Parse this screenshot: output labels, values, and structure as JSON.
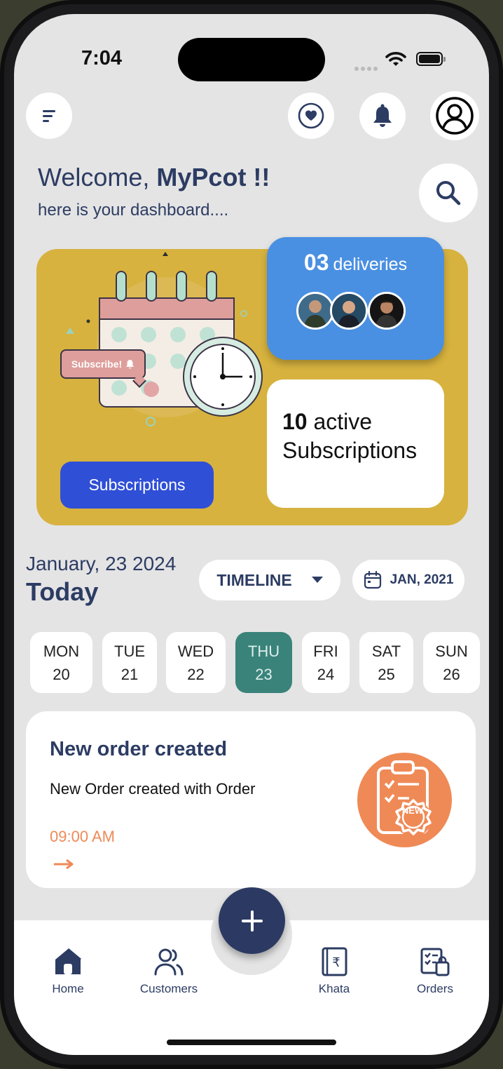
{
  "status_bar": {
    "time": "7:04"
  },
  "header": {
    "welcome_prefix": "Welcome,",
    "user_name": "MyPcot !!",
    "subtitle": "here is your dashboard...."
  },
  "hero": {
    "deliveries_count": "03",
    "deliveries_label": "deliveries",
    "subscribe_tag": "Subscribe!",
    "active_count": "10",
    "active_label": "active",
    "subscriptions_word": "Subscriptions",
    "subscriptions_button": "Subscriptions"
  },
  "dates": {
    "current_date": "January, 23 2024",
    "today_label": "Today",
    "timeline_label": "TIMELINE",
    "month_label": "JAN, 2021",
    "days": [
      {
        "name": "MON",
        "num": "20"
      },
      {
        "name": "TUE",
        "num": "21"
      },
      {
        "name": "WED",
        "num": "22"
      },
      {
        "name": "THU",
        "num": "23"
      },
      {
        "name": "FRI",
        "num": "24"
      },
      {
        "name": "SAT",
        "num": "25"
      },
      {
        "name": "SUN",
        "num": "26"
      }
    ],
    "selected_day": "THU"
  },
  "order_card": {
    "title": "New order created",
    "description": "New Order created with Order",
    "time": "09:00 AM",
    "badge": "NEW"
  },
  "bottom_nav": {
    "items": [
      {
        "label": "Home",
        "icon": "home-icon"
      },
      {
        "label": "Customers",
        "icon": "customers-icon"
      },
      {
        "label": "Khata",
        "icon": "khata-book-icon"
      },
      {
        "label": "Orders",
        "icon": "orders-icon"
      }
    ],
    "fab_icon": "plus-icon"
  },
  "colors": {
    "primary_navy": "#2c3c63",
    "hero_gold": "#d7b23e",
    "delivery_blue": "#4a90e2",
    "button_blue": "#2f4fd6",
    "selected_teal": "#3a837a",
    "accent_orange": "#ef8a56",
    "background": "#e4e4e4"
  }
}
